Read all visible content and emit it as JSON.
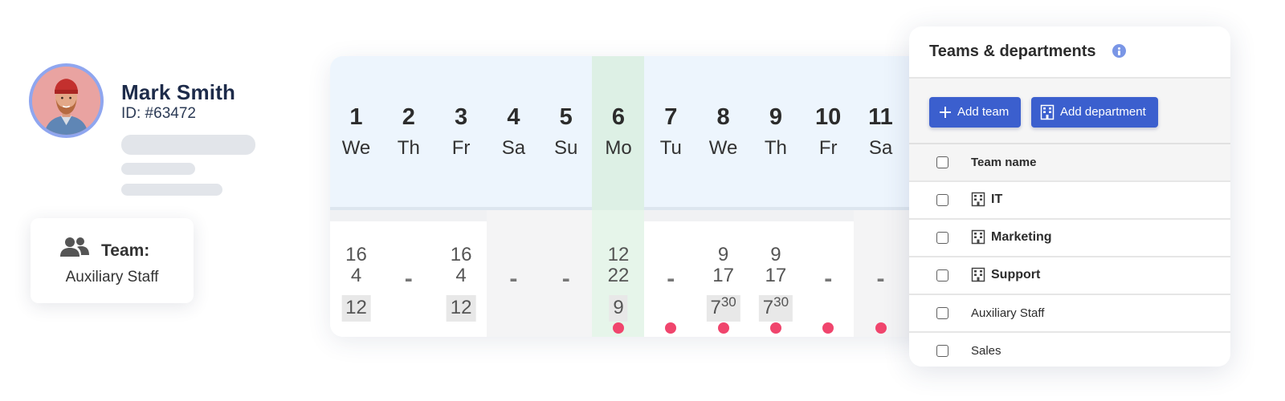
{
  "profile": {
    "name": "Mark Smith",
    "id": "ID: #63472"
  },
  "team_card": {
    "label": "Team:",
    "value": "Auxiliary Staff",
    "icon": "people-icon"
  },
  "calendar": {
    "days": [
      {
        "num": "1",
        "name": "We",
        "v1": "16",
        "v2": "4",
        "hours": "12"
      },
      {
        "num": "2",
        "name": "Th",
        "dash": "-"
      },
      {
        "num": "3",
        "name": "Fr",
        "v1": "16",
        "v2": "4",
        "hours": "12"
      },
      {
        "num": "4",
        "name": "Sa",
        "dash": "-"
      },
      {
        "num": "5",
        "name": "Su",
        "dash": "-"
      },
      {
        "num": "6",
        "name": "Mo",
        "v1": "12",
        "v2": "22",
        "hours": "9",
        "dot": true,
        "today": true
      },
      {
        "num": "7",
        "name": "Tu",
        "dash": "-",
        "dot": true
      },
      {
        "num": "8",
        "name": "We",
        "v1": "9",
        "v2": "17",
        "hours": "7",
        "hours_sup": "30",
        "dot": true
      },
      {
        "num": "9",
        "name": "Th",
        "v1": "9",
        "v2": "17",
        "hours": "7",
        "hours_sup": "30",
        "dot": true
      },
      {
        "num": "10",
        "name": "Fr",
        "dash": "-",
        "dot": true
      },
      {
        "num": "11",
        "name": "Sa",
        "dash": "-",
        "dot": true
      }
    ],
    "colors": {
      "today": "#ddf0e5",
      "header": "#edf5fd",
      "dot": "#f0456d"
    }
  },
  "teams_panel": {
    "title": "Teams & departments",
    "add_team_label": "Add team",
    "add_department_label": "Add department",
    "column_header": "Team name",
    "rows": [
      {
        "name": "IT",
        "department": true
      },
      {
        "name": "Marketing",
        "department": true
      },
      {
        "name": "Support",
        "department": true
      },
      {
        "name": "Auxiliary Staff",
        "department": false
      },
      {
        "name": "Sales",
        "department": false
      }
    ],
    "accent": "#3b5fce"
  }
}
